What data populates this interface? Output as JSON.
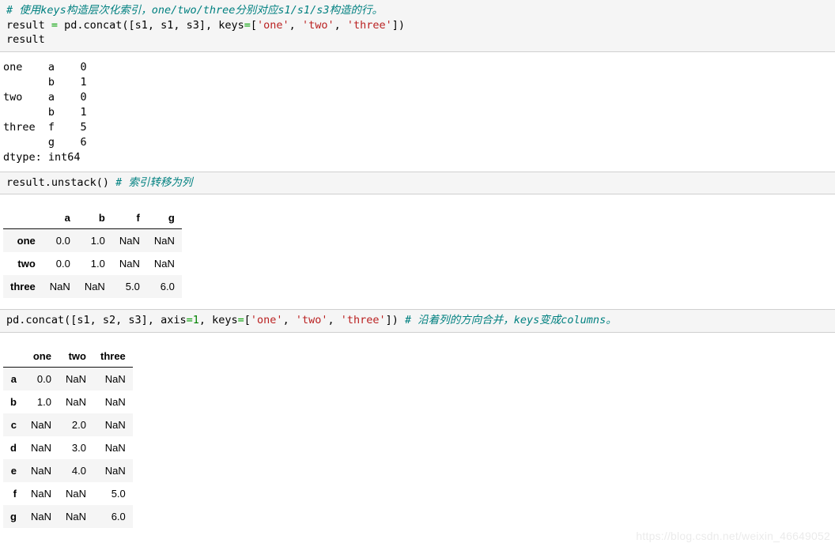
{
  "cells": [
    {
      "id": "cell-concat-keys",
      "type": "code",
      "lines": [
        {
          "segments": [
            {
              "kind": "comment",
              "text": "# 使用keys构造层次化索引，one/two/three分别对应s1/s1/s3构造的行。"
            }
          ]
        },
        {
          "segments": [
            {
              "kind": "plain",
              "text": "result "
            },
            {
              "kind": "eq",
              "text": "="
            },
            {
              "kind": "plain",
              "text": " pd.concat([s1, s1, s3], keys"
            },
            {
              "kind": "eq",
              "text": "="
            },
            {
              "kind": "plain",
              "text": "["
            },
            {
              "kind": "string",
              "text": "'one'"
            },
            {
              "kind": "plain",
              "text": ", "
            },
            {
              "kind": "string",
              "text": "'two'"
            },
            {
              "kind": "plain",
              "text": ", "
            },
            {
              "kind": "string",
              "text": "'three'"
            },
            {
              "kind": "plain",
              "text": "])"
            }
          ]
        },
        {
          "segments": [
            {
              "kind": "plain",
              "text": "result"
            }
          ]
        }
      ]
    },
    {
      "id": "output-series",
      "type": "text-output",
      "text": "one    a    0\n       b    1\ntwo    a    0\n       b    1\nthree  f    5\n       g    6\ndtype: int64"
    },
    {
      "id": "cell-unstack",
      "type": "code",
      "lines": [
        {
          "segments": [
            {
              "kind": "plain",
              "text": "result.unstack() "
            },
            {
              "kind": "comment",
              "text": "# 索引转移为列"
            }
          ]
        }
      ]
    },
    {
      "id": "output-unstack-table",
      "type": "table",
      "table": {
        "index_header": "",
        "columns": [
          "a",
          "b",
          "f",
          "g"
        ],
        "rows": [
          {
            "index": "one",
            "values": [
              "0.0",
              "1.0",
              "NaN",
              "NaN"
            ]
          },
          {
            "index": "two",
            "values": [
              "0.0",
              "1.0",
              "NaN",
              "NaN"
            ]
          },
          {
            "index": "three",
            "values": [
              "NaN",
              "NaN",
              "5.0",
              "6.0"
            ]
          }
        ]
      }
    },
    {
      "id": "cell-concat-axis1",
      "type": "code",
      "lines": [
        {
          "segments": [
            {
              "kind": "plain",
              "text": "pd.concat([s1, s2, s3], axis"
            },
            {
              "kind": "eq",
              "text": "="
            },
            {
              "kind": "num",
              "text": "1"
            },
            {
              "kind": "plain",
              "text": ", keys"
            },
            {
              "kind": "eq",
              "text": "="
            },
            {
              "kind": "plain",
              "text": "["
            },
            {
              "kind": "string",
              "text": "'one'"
            },
            {
              "kind": "plain",
              "text": ", "
            },
            {
              "kind": "string",
              "text": "'two'"
            },
            {
              "kind": "plain",
              "text": ", "
            },
            {
              "kind": "string",
              "text": "'three'"
            },
            {
              "kind": "plain",
              "text": "]) "
            },
            {
              "kind": "comment",
              "text": "# 沿着列的方向合并，keys变成columns。"
            }
          ]
        }
      ]
    },
    {
      "id": "output-concat-table",
      "type": "table",
      "table": {
        "index_header": "",
        "columns": [
          "one",
          "two",
          "three"
        ],
        "rows": [
          {
            "index": "a",
            "values": [
              "0.0",
              "NaN",
              "NaN"
            ]
          },
          {
            "index": "b",
            "values": [
              "1.0",
              "NaN",
              "NaN"
            ]
          },
          {
            "index": "c",
            "values": [
              "NaN",
              "2.0",
              "NaN"
            ]
          },
          {
            "index": "d",
            "values": [
              "NaN",
              "3.0",
              "NaN"
            ]
          },
          {
            "index": "e",
            "values": [
              "NaN",
              "4.0",
              "NaN"
            ]
          },
          {
            "index": "f",
            "values": [
              "NaN",
              "NaN",
              "5.0"
            ]
          },
          {
            "index": "g",
            "values": [
              "NaN",
              "NaN",
              "6.0"
            ]
          }
        ]
      }
    }
  ],
  "watermark": {
    "text": "https://blog.csdn.net/weixin_46649052"
  },
  "colors": {
    "cell_background": "#f5f5f5",
    "cell_border": "#cfcfcf",
    "comment": "#008080",
    "string": "#ba2121",
    "operator": "#00a000",
    "number": "#008000",
    "text": "#000000",
    "watermark": "#ebebeb",
    "table_stripe": "#f5f5f5",
    "table_header_rule": "#111111"
  }
}
